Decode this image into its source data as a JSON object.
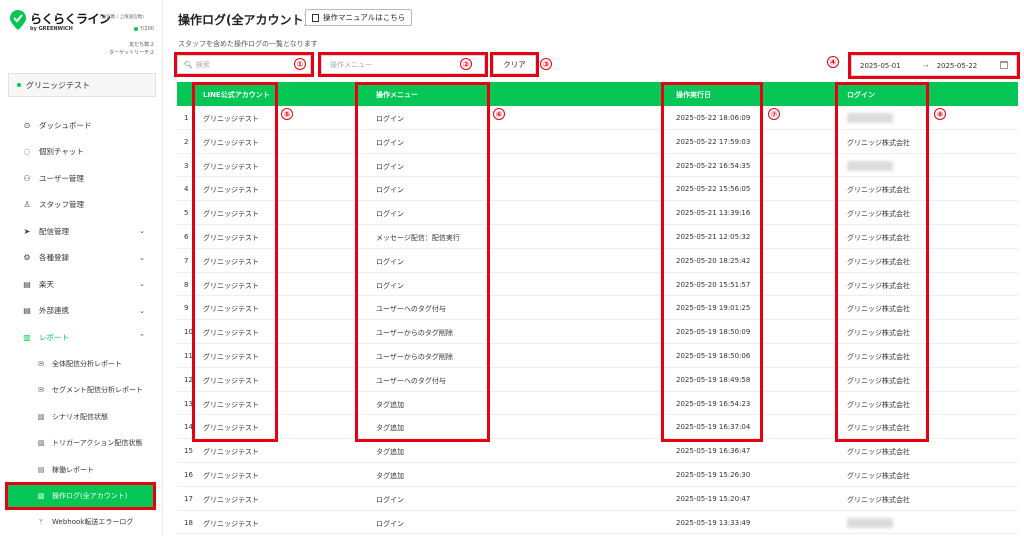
{
  "sidebar": {
    "logo_title": "らくらくライン",
    "logo_sub": "(送信数 / 上限送信数)",
    "logo_by": "by GREENWICH",
    "quota": "7/200",
    "friends": "友だち数:2",
    "target_reach": "ターゲットリーチ:2",
    "account_name": "グリニッジテスト",
    "items": [
      {
        "label": "ダッシュボード",
        "icon": "⊙"
      },
      {
        "label": "個別チャット",
        "icon": "◌"
      },
      {
        "label": "ユーザー管理",
        "icon": "⚇"
      },
      {
        "label": "スタッフ管理",
        "icon": "♙"
      },
      {
        "label": "配信管理",
        "icon": "➤"
      },
      {
        "label": "各種登録",
        "icon": "⚙"
      },
      {
        "label": "楽天",
        "icon": "▤"
      },
      {
        "label": "外部連携",
        "icon": "▤"
      },
      {
        "label": "レポート",
        "icon": "▥"
      }
    ],
    "subitems": [
      {
        "label": "全体配信分析レポート",
        "icon": "✉"
      },
      {
        "label": "セグメント配信分析レポート",
        "icon": "✉"
      },
      {
        "label": "シナリオ配信状態",
        "icon": "▧"
      },
      {
        "label": "トリガーアクション配信状態",
        "icon": "▧"
      },
      {
        "label": "稼働レポート",
        "icon": "▤"
      },
      {
        "label": "操作ログ(全アカウント)",
        "icon": "▧"
      },
      {
        "label": "Webhook転送エラーログ",
        "icon": "ᛘ"
      }
    ]
  },
  "header": {
    "title": "操作ログ(全アカウント)",
    "manual_button": "操作マニュアルはこちら",
    "subtitle": "スタッフを含めた操作ログの一覧となります"
  },
  "filters": {
    "search_placeholder": "検索",
    "op_menu_placeholder": "操作メニュー",
    "clear_label": "クリア",
    "date_from": "2025-05-01",
    "date_arrow": "→",
    "date_to": "2025-05-22"
  },
  "markers": [
    "①",
    "②",
    "③",
    "④",
    "⑤",
    "⑥",
    "⑦",
    "⑧"
  ],
  "table": {
    "headers": [
      "LINE公式アカウント",
      "操作メニュー",
      "操作実行日",
      "ログイン"
    ],
    "rows": [
      {
        "n": "1",
        "account": "グリニッジテスト",
        "menu": "ログイン",
        "date": "2025-05-22 18:06:09",
        "login": ""
      },
      {
        "n": "2",
        "account": "グリニッジテスト",
        "menu": "ログイン",
        "date": "2025-05-22 17:59:03",
        "login": "グリニッジ株式会社"
      },
      {
        "n": "3",
        "account": "グリニッジテスト",
        "menu": "ログイン",
        "date": "2025-05-22 16:54:35",
        "login": ""
      },
      {
        "n": "4",
        "account": "グリニッジテスト",
        "menu": "ログイン",
        "date": "2025-05-22 15:56:05",
        "login": "グリニッジ株式会社"
      },
      {
        "n": "5",
        "account": "グリニッジテスト",
        "menu": "ログイン",
        "date": "2025-05-21 13:39:16",
        "login": "グリニッジ株式会社"
      },
      {
        "n": "6",
        "account": "グリニッジテスト",
        "menu": "メッセージ配信：配信実行",
        "date": "2025-05-21 12:05:32",
        "login": "グリニッジ株式会社"
      },
      {
        "n": "7",
        "account": "グリニッジテスト",
        "menu": "ログイン",
        "date": "2025-05-20 18:25:42",
        "login": "グリニッジ株式会社"
      },
      {
        "n": "8",
        "account": "グリニッジテスト",
        "menu": "ログイン",
        "date": "2025-05-20 15:51:57",
        "login": "グリニッジ株式会社"
      },
      {
        "n": "9",
        "account": "グリニッジテスト",
        "menu": "ユーザーへのタグ付与",
        "date": "2025-05-19 19:01:25",
        "login": "グリニッジ株式会社"
      },
      {
        "n": "10",
        "account": "グリニッジテスト",
        "menu": "ユーザーからのタグ削除",
        "date": "2025-05-19 18:50:09",
        "login": "グリニッジ株式会社"
      },
      {
        "n": "11",
        "account": "グリニッジテスト",
        "menu": "ユーザーからのタグ削除",
        "date": "2025-05-19 18:50:06",
        "login": "グリニッジ株式会社"
      },
      {
        "n": "12",
        "account": "グリニッジテスト",
        "menu": "ユーザーへのタグ付与",
        "date": "2025-05-19 18:49:58",
        "login": "グリニッジ株式会社"
      },
      {
        "n": "13",
        "account": "グリニッジテスト",
        "menu": "タグ追加",
        "date": "2025-05-19 16:54:23",
        "login": "グリニッジ株式会社"
      },
      {
        "n": "14",
        "account": "グリニッジテスト",
        "menu": "タグ追加",
        "date": "2025-05-19 16:37:04",
        "login": "グリニッジ株式会社"
      },
      {
        "n": "15",
        "account": "グリニッジテスト",
        "menu": "タグ追加",
        "date": "2025-05-19 16:36:47",
        "login": "グリニッジ株式会社"
      },
      {
        "n": "16",
        "account": "グリニッジテスト",
        "menu": "タグ追加",
        "date": "2025-05-19 15:26:30",
        "login": "グリニッジ株式会社"
      },
      {
        "n": "17",
        "account": "グリニッジテスト",
        "menu": "ログイン",
        "date": "2025-05-19 15:20:47",
        "login": "グリニッジ株式会社"
      },
      {
        "n": "18",
        "account": "グリニッジテスト",
        "menu": "ログイン",
        "date": "2025-05-19 13:33:49",
        "login": ""
      }
    ]
  },
  "colors": {
    "brand_green": "#06c755",
    "highlight_red": "#e60012"
  }
}
